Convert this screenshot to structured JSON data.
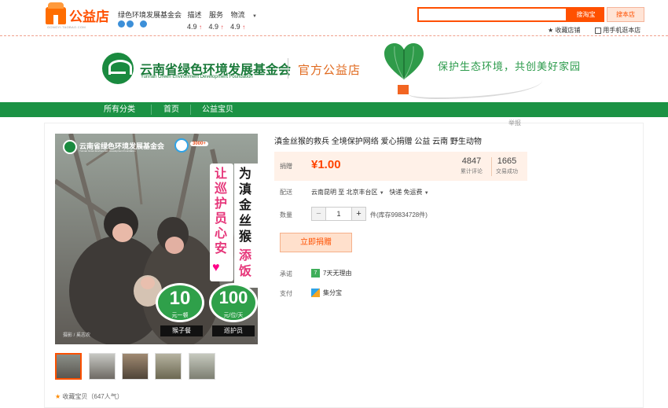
{
  "topbar": {
    "logo_text": "公益店",
    "logo_sub": "GONGYI.TAOBAO.COM",
    "shop_name": "绿色环境发展基金会",
    "scores": [
      {
        "label": "描述",
        "value": "4.9"
      },
      {
        "label": "服务",
        "value": "4.9"
      },
      {
        "label": "物流",
        "value": "4.9"
      }
    ],
    "search_placeholder": "",
    "btn_taobao": "搜淘宝",
    "btn_shop": "搜本店",
    "fav_shop": "收藏店铺",
    "mobile": "用手机逛本店"
  },
  "banner": {
    "org_cn": "云南省绿色环境发展基金会",
    "org_en": "Yunnan Green Environment Development Foundation",
    "official": "官方公益店",
    "tagline": "保护生态环境，共创美好家园"
  },
  "nav": {
    "items": [
      "所有分类",
      "首页",
      "公益宝贝"
    ]
  },
  "product": {
    "report": "举报",
    "title": "滇金丝猴的救兵 全境保护网络 爱心捐赠 公益 云南 野生动物",
    "price_label": "捐赠",
    "price": "¥1.00",
    "reviews_count": "4847",
    "reviews_label": "累计评论",
    "deals_count": "1665",
    "deals_label": "交易成功",
    "ship_label": "配送",
    "ship_text": "云南昆明 至 北京丰台区",
    "ship_method": "快递 免运费",
    "qty_label": "数量",
    "qty_value": "1",
    "stock": "件(库存99834728件)",
    "donate_button": "立即捐赠",
    "promise_label": "承诺",
    "promise_text": "7天无理由",
    "pay_label": "支付",
    "pay_text": "集分宝",
    "favorite": "收藏宝贝（647人气）"
  },
  "poster": {
    "org": "云南省绿色环境发展基金会",
    "org_en": "Yunnan Green Environment Development Foundation",
    "headline_left": "让巡护员心安",
    "headline_right_1": "为滇金丝猴",
    "headline_right_2": "添饭",
    "price1": "10",
    "price1_unit": "元一顿",
    "price1_label": "猴子餐",
    "price2": "100",
    "price2_unit": "元/位/天",
    "price2_label": "巡护员",
    "credit": "摄影 / 奚志农",
    "tag": "3000+"
  },
  "colors": {
    "brand_orange": "#ff5000",
    "nav_green": "#1b9244",
    "price_red": "#ff4400"
  }
}
